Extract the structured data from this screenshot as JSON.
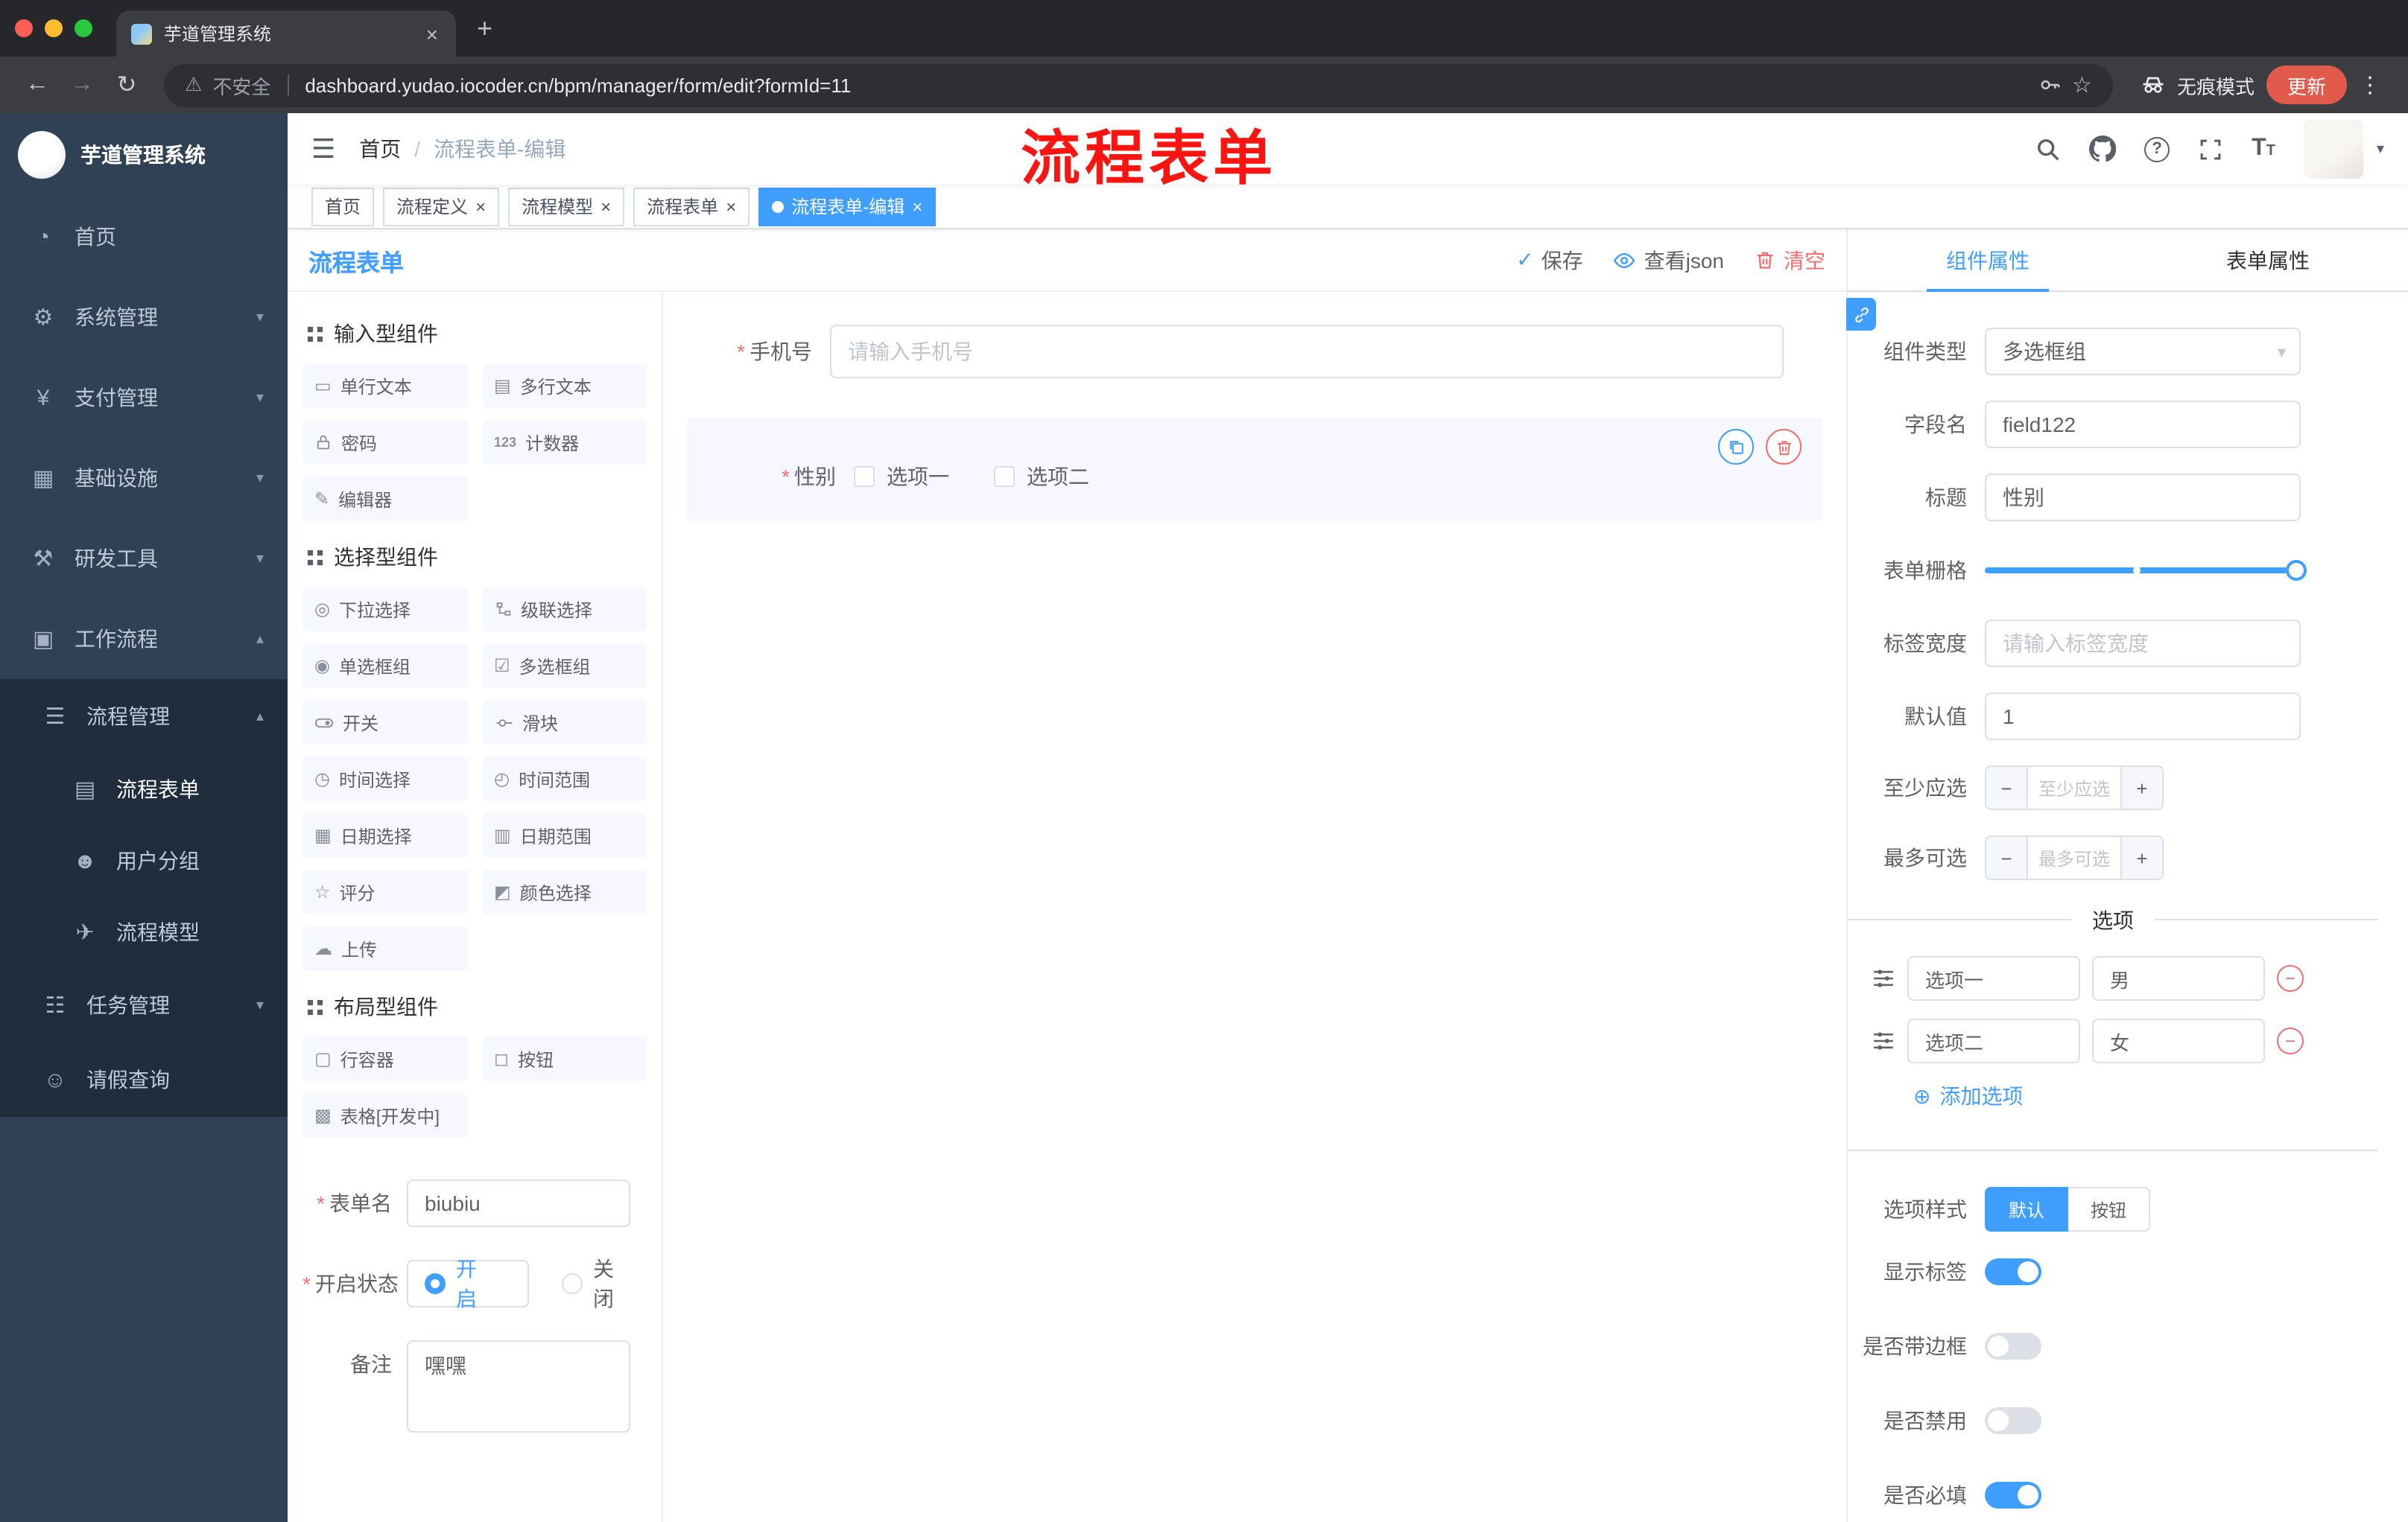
{
  "glyphs": {
    "required": "*",
    "close": "×",
    "new_tab": "+",
    "breadcrumb_sep": "/",
    "minus": "−",
    "plus": "+",
    "dots_menu": "⋮",
    "caret_down": "▾",
    "chevron_down": "▾",
    "chevron_up": "▴",
    "check": "✓",
    "add_circle": "⊕",
    "question": "?"
  },
  "icons": {
    "back": "←",
    "forward": "→",
    "reload": "↻",
    "warning": "⚠",
    "star": "☆",
    "hamburger": "☰",
    "text_large": "T",
    "text_small": "T",
    "dashboard": "◔",
    "gear": "⚙",
    "yen": "¥",
    "infra": "▦",
    "tools": "⚒",
    "workflow": "▣",
    "process_list": "☰",
    "form_doc": "▤",
    "users": "☻",
    "plane": "✈",
    "tree": "☷",
    "person": "☺",
    "single_line": "▭",
    "multi_line": "▤",
    "counter": "123",
    "editor": "✎",
    "dropdown": "◎",
    "radio": "◉",
    "checkbox": "☑",
    "time": "◷",
    "time_range": "◴",
    "date": "▦",
    "date_range": "▥",
    "rate": "☆",
    "color": "◩",
    "upload": "☁",
    "row_container": "▢",
    "button": "◻",
    "table": "▩"
  },
  "browser": {
    "tab_title": "芋道管理系统",
    "security_label": "不安全",
    "url": "dashboard.yudao.iocoder.cn/bpm/manager/form/edit?formId=11",
    "incognito_label": "无痕模式",
    "update_label": "更新"
  },
  "sidebar": {
    "app_title": "芋道管理系统",
    "items": [
      "首页",
      "系统管理",
      "支付管理",
      "基础设施",
      "研发工具",
      "工作流程"
    ],
    "submenu_title": "流程管理",
    "submenu_items": [
      "流程表单",
      "用户分组",
      "流程模型"
    ],
    "task_item": "任务管理",
    "leave_item": "请假查询"
  },
  "header": {
    "breadcrumb_home": "首页",
    "breadcrumb_current": "流程表单-编辑",
    "annotation": "流程表单"
  },
  "tags": [
    {
      "label": "首页"
    },
    {
      "label": "流程定义"
    },
    {
      "label": "流程模型"
    },
    {
      "label": "流程表单"
    },
    {
      "label": "流程表单-编辑"
    }
  ],
  "designer": {
    "title": "流程表单",
    "save_label": "保存",
    "view_json_label": "查看json",
    "clear_label": "清空",
    "groups": [
      {
        "title": "输入型组件",
        "items": [
          "单行文本",
          "多行文本",
          "密码",
          "计数器",
          "编辑器"
        ]
      },
      {
        "title": "选择型组件",
        "items": [
          "下拉选择",
          "级联选择",
          "单选框组",
          "多选框组",
          "开关",
          "滑块",
          "时间选择",
          "时间范围",
          "日期选择",
          "日期范围",
          "评分",
          "颜色选择",
          "上传"
        ]
      },
      {
        "title": "布局型组件",
        "items": [
          "行容器",
          "按钮",
          "表格[开发中]"
        ]
      }
    ],
    "meta": {
      "name_label": "表单名",
      "name_value": "biubiu",
      "status_label": "开启状态",
      "status_on": "开启",
      "status_off": "关闭",
      "remark_label": "备注",
      "remark_value": "嘿嘿"
    },
    "canvas": {
      "phone_label": "手机号",
      "phone_placeholder": "请输入手机号",
      "gender_label": "性别",
      "gender_option1": "选项一",
      "gender_option2": "选项二"
    }
  },
  "props": {
    "tab_component": "组件属性",
    "tab_form": "表单属性",
    "type_label": "组件类型",
    "type_value": "多选框组",
    "field_label": "字段名",
    "field_value": "field122",
    "title_label": "标题",
    "title_value": "性别",
    "grid_label": "表单栅格",
    "labelwidth_label": "标签宽度",
    "labelwidth_placeholder": "请输入标签宽度",
    "default_label": "默认值",
    "default_value": "1",
    "min_label": "至少应选",
    "min_placeholder": "至少应选",
    "max_label": "最多可选",
    "max_placeholder": "最多可选",
    "options_divider": "选项",
    "options": [
      {
        "label": "选项一",
        "value": "男"
      },
      {
        "label": "选项二",
        "value": "女"
      }
    ],
    "add_option": "添加选项",
    "option_style_label": "选项样式",
    "style_default": "默认",
    "style_button": "按钮",
    "show_label_label": "显示标签",
    "border_label": "是否带边框",
    "disabled_label": "是否禁用",
    "required_label": "是否必填"
  },
  "colors": {
    "accent": "#409eff",
    "danger": "#f56c6c",
    "annotation": "#fb1410"
  }
}
